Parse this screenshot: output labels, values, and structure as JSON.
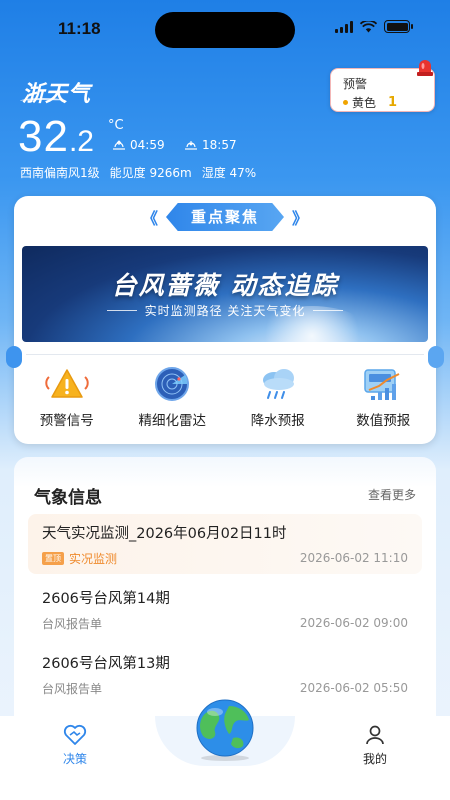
{
  "status_bar": {
    "time": "11:18"
  },
  "header": {
    "logo": "浙天气",
    "temp_int": "32",
    "temp_dec": ".2",
    "temp_unit": "°C",
    "sunrise": "04:59",
    "sunset": "18:57",
    "wind": "西南偏南风1级",
    "visibility": "能见度 9266m",
    "humidity": "湿度 47%"
  },
  "warning": {
    "title": "预警",
    "level": "黄色",
    "count": "1",
    "level_color": "#f0a400"
  },
  "focus": {
    "title": "重点聚焦",
    "banner_title": "台风蔷薇  动态追踪",
    "banner_subtitle": "实时监测路径 关注天气变化",
    "shortcuts": [
      {
        "label": "预警信号",
        "icon": "warning-signal-icon"
      },
      {
        "label": "精细化雷达",
        "icon": "radar-icon"
      },
      {
        "label": "降水预报",
        "icon": "rain-forecast-icon"
      },
      {
        "label": "数值预报",
        "icon": "numeric-forecast-icon"
      }
    ]
  },
  "weather_info": {
    "title": "气象信息",
    "more": "查看更多",
    "items": [
      {
        "title": "天气实况监测_2026年06月02日11时",
        "chip": "置顶",
        "tag": "实况监测",
        "time": "2026-06-02 11:10"
      },
      {
        "title": "2606号台风第14期",
        "tag": "台风报告单",
        "time": "2026-06-02 09:00"
      },
      {
        "title": "2606号台风第13期",
        "tag": "台风报告单",
        "time": "2026-06-02 05:50"
      }
    ]
  },
  "nav": {
    "decision": "决策",
    "mine": "我的",
    "accent": "#2f86ea"
  }
}
